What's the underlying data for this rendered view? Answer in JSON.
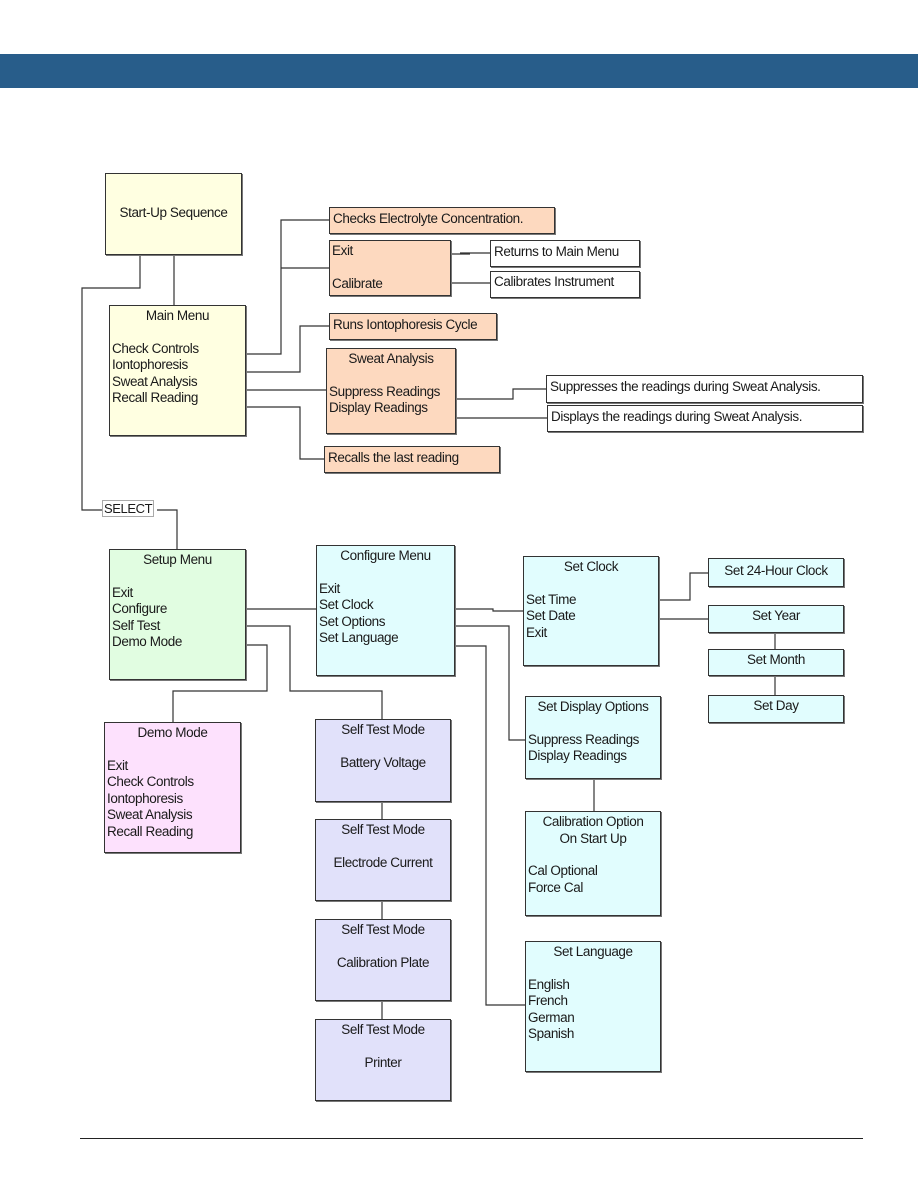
{
  "header": {
    "color": "#285d8a"
  },
  "diagram": {
    "startup": {
      "title": "Start-Up Sequence"
    },
    "main_menu": {
      "title": "Main Menu",
      "items": [
        "Check Controls",
        "Iontophoresis",
        "Sweat Analysis",
        "Recall Reading"
      ]
    },
    "check_controls_desc": "Checks Electrolyte Concentration.",
    "check_controls_sub": {
      "items": [
        "Exit",
        "Calibrate"
      ]
    },
    "returns_main": "Returns to Main Menu",
    "calibrates_instrument": "Calibrates Instrument",
    "iontophoresis_desc": "Runs Iontophoresis Cycle",
    "sweat_analysis": {
      "title": "Sweat Analysis",
      "items": [
        "Suppress Readings",
        "Display Readings"
      ]
    },
    "suppress_desc": "Suppresses the readings during Sweat Analysis.",
    "display_desc": "Displays the readings during Sweat Analysis.",
    "recall_desc": "Recalls the last reading",
    "select_label": "SELECT",
    "setup_menu": {
      "title": "Setup Menu",
      "items": [
        "Exit",
        "Configure",
        "Self Test",
        "Demo Mode"
      ]
    },
    "configure_menu": {
      "title": "Configure Menu",
      "items": [
        "Exit",
        "Set Clock",
        "Set Options",
        "Set Language"
      ]
    },
    "set_clock": {
      "title": "Set Clock",
      "items": [
        "Set Time",
        "Set Date",
        "Exit"
      ]
    },
    "set_24h": "Set 24-Hour Clock",
    "set_year": "Set Year",
    "set_month": "Set Month",
    "set_day": "Set Day",
    "demo_mode": {
      "title": "Demo Mode",
      "items": [
        "Exit",
        "Check Controls",
        "Iontophoresis",
        "Sweat Analysis",
        "Recall Reading"
      ]
    },
    "self_test": [
      {
        "title": "Self Test Mode",
        "label": "Battery Voltage"
      },
      {
        "title": "Self Test Mode",
        "label": "Electrode Current"
      },
      {
        "title": "Self Test Mode",
        "label": "Calibration Plate"
      },
      {
        "title": "Self Test Mode",
        "label": "Printer"
      }
    ],
    "display_options": {
      "title": "Set Display Options",
      "items": [
        "Suppress Readings",
        "Display Readings"
      ]
    },
    "calibration_option": {
      "title_line1": "Calibration Option",
      "title_line2": "On Start Up",
      "items": [
        "Cal Optional",
        "Force Cal"
      ]
    },
    "set_language": {
      "title": "Set Language",
      "items": [
        "English",
        "French",
        "German",
        "Spanish"
      ]
    }
  }
}
